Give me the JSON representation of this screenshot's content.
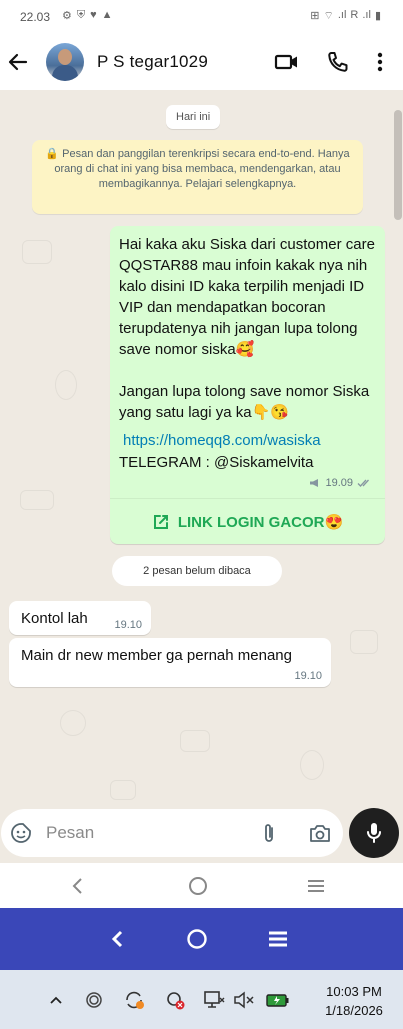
{
  "status_bar": {
    "time": "22.03",
    "left_icons": [
      "gear-icon",
      "shield-icon",
      "heart-icon",
      "warning-icon"
    ],
    "signal_label": "R"
  },
  "header": {
    "contact_name": "P S tegar1029"
  },
  "chat": {
    "date_chip": "Hari ini",
    "encryption_notice": "🔒 Pesan dan panggilan terenkripsi secara end-to-end. Hanya orang di chat ini yang bisa membaca, mendengarkan, atau membagikannya. Pelajari selengkapnya.",
    "outgoing": {
      "text": "Hai kaka aku Siska dari customer care QQSTAR88 mau infoin kakak nya nih kalo disini ID kaka terpilih menjadi ID VIP dan mendapatkan bocoran terupdatenya nih jangan lupa tolong save nomor siska🥰\n\nJangan lupa tolong save nomor Siska yang satu lagi ya ka👇😘",
      "link": "https://homeqq8.com/wasiska",
      "telegram": "TELEGRAM : @Siskamelvita",
      "time": "19.09",
      "cta": "LINK LOGIN GACOR😍"
    },
    "unread_chip": "2 pesan belum dibaca",
    "incoming": [
      {
        "text": "Kontol lah",
        "time": "19.10"
      },
      {
        "text": "Main dr new member ga pernah menang",
        "time": "19.10"
      }
    ]
  },
  "input": {
    "placeholder": "Pesan"
  },
  "taskbar": {
    "time": "10:03 PM",
    "date": "1/18/2026"
  },
  "colors": {
    "chat_bg": "#efeae2",
    "outgoing_bubble": "#d9fdd3",
    "encryption_bg": "#fdf4c5",
    "link": "#027eb5",
    "cta_green": "#1fa855",
    "nav_blue": "#3a47b8",
    "taskbar_bg": "#dfe6ef"
  }
}
